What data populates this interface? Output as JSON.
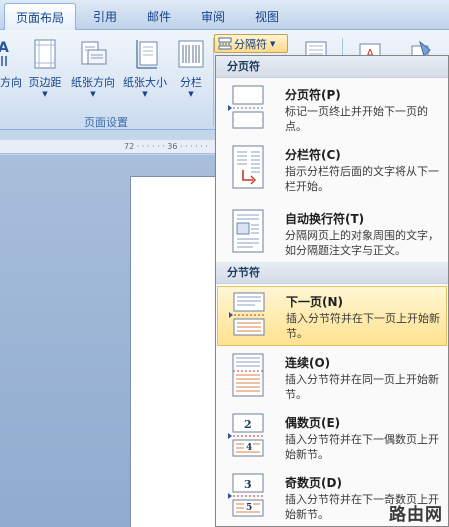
{
  "tabs": [
    {
      "label": "页面布局",
      "active": true
    },
    {
      "label": "引用"
    },
    {
      "label": "邮件"
    },
    {
      "label": "审阅"
    },
    {
      "label": "视图"
    }
  ],
  "ribbon": {
    "buttons": [
      {
        "label": "方向"
      },
      {
        "label": "页边距"
      },
      {
        "label": "纸张方向"
      },
      {
        "label": "纸张大小"
      },
      {
        "label": "分栏"
      }
    ],
    "group_label": "页面设置",
    "breaks_button": {
      "label": "分隔符"
    }
  },
  "ruler": {
    "text": "72 · · · · · · 36 · · · · · ·"
  },
  "menu": {
    "sections": [
      {
        "header": "分页符",
        "items": [
          {
            "title": "分页符(P)",
            "desc": "标记一页终止并开始下一页的点。",
            "icon": "page-break-icon"
          },
          {
            "title": "分栏符(C)",
            "desc": "指示分栏符后面的文字将从下一栏开始。",
            "icon": "column-break-icon"
          },
          {
            "title": "自动换行符(T)",
            "desc": "分隔网页上的对象周围的文字，如分隔题注文字与正文。",
            "icon": "text-wrapping-break-icon"
          }
        ]
      },
      {
        "header": "分节符",
        "items": [
          {
            "title": "下一页(N)",
            "desc": "插入分节符并在下一页上开始新节。",
            "icon": "next-page-section-icon",
            "highlighted": true
          },
          {
            "title": "连续(O)",
            "desc": "插入分节符并在同一页上开始新节。",
            "icon": "continuous-section-icon"
          },
          {
            "title": "偶数页(E)",
            "desc": "插入分节符并在下一偶数页上开始新节。",
            "icon": "even-page-section-icon",
            "num": "2"
          },
          {
            "title": "奇数页(D)",
            "desc": "插入分节符并在下一奇数页上开始新节。",
            "icon": "odd-page-section-icon",
            "num": "3"
          }
        ]
      }
    ]
  },
  "watermark": "路由网"
}
